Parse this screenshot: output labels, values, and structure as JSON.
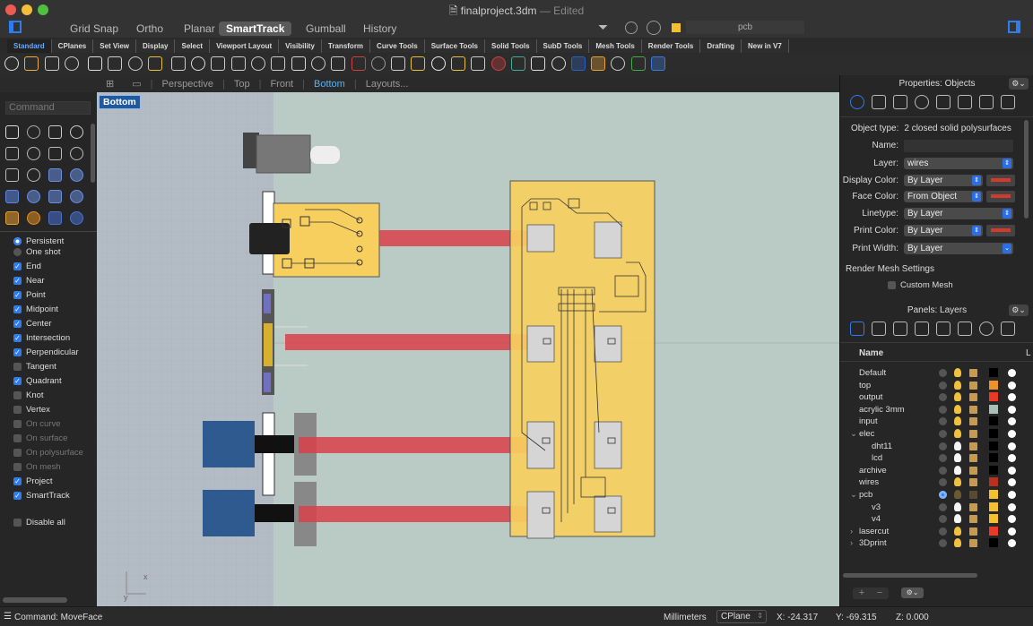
{
  "window": {
    "title": "finalproject.3dm",
    "edited": "— Edited",
    "layer_field": "pcb"
  },
  "modes": [
    "Grid Snap",
    "Ortho",
    "Planar",
    "SmartTrack",
    "Gumball",
    "History"
  ],
  "active_mode": "SmartTrack",
  "tabs": [
    "Standard",
    "CPlanes",
    "Set View",
    "Display",
    "Select",
    "Viewport Layout",
    "Visibility",
    "Transform",
    "Curve Tools",
    "Surface Tools",
    "Solid Tools",
    "SubD Tools",
    "Mesh Tools",
    "Render Tools",
    "Drafting",
    "New in V7"
  ],
  "active_tab": "Standard",
  "viewport_tabs": [
    "Perspective",
    "Top",
    "Front",
    "Bottom",
    "Layouts..."
  ],
  "active_viewport": "Bottom",
  "viewport_label": "Bottom",
  "axis": {
    "x": "x",
    "y": "y"
  },
  "command": {
    "placeholder": "Command"
  },
  "osnap": {
    "mode": [
      {
        "label": "Persistent",
        "on": true
      },
      {
        "label": "One shot",
        "on": false
      }
    ],
    "items": [
      {
        "label": "End",
        "on": true
      },
      {
        "label": "Near",
        "on": true
      },
      {
        "label": "Point",
        "on": true
      },
      {
        "label": "Midpoint",
        "on": true
      },
      {
        "label": "Center",
        "on": true
      },
      {
        "label": "Intersection",
        "on": true
      },
      {
        "label": "Perpendicular",
        "on": true
      },
      {
        "label": "Tangent",
        "on": false
      },
      {
        "label": "Quadrant",
        "on": true
      },
      {
        "label": "Knot",
        "on": false
      },
      {
        "label": "Vertex",
        "on": false
      },
      {
        "label": "On curve",
        "on": false,
        "disabled": true
      },
      {
        "label": "On surface",
        "on": false,
        "disabled": true
      },
      {
        "label": "On polysurface",
        "on": false,
        "disabled": true
      },
      {
        "label": "On mesh",
        "on": false,
        "disabled": true
      },
      {
        "label": "Project",
        "on": true
      },
      {
        "label": "SmartTrack",
        "on": true
      }
    ],
    "disable_all": "Disable all"
  },
  "properties": {
    "title": "Properties: Objects",
    "object_type_label": "Object type:",
    "object_type": "2 closed solid polysurfaces",
    "name_label": "Name:",
    "name_value": "",
    "layer_label": "Layer:",
    "layer": "wires",
    "display_color_label": "Display Color:",
    "display_color": "By Layer",
    "face_color_label": "Face Color:",
    "face_color": "From Object",
    "linetype_label": "Linetype:",
    "linetype": "By Layer",
    "print_color_label": "Print Color:",
    "print_color": "By Layer",
    "print_width_label": "Print Width:",
    "print_width": "By Layer",
    "render_mesh": "Render Mesh Settings",
    "custom_mesh": "Custom Mesh",
    "swatch_color": "#d03b2b"
  },
  "layers": {
    "title": "Panels: Layers",
    "name_header": "Name",
    "col_l": "L",
    "rows": [
      {
        "name": "Default",
        "indent": 0,
        "color": "#000000",
        "light": "on"
      },
      {
        "name": "top",
        "indent": 0,
        "color": "#f0902a",
        "light": "on"
      },
      {
        "name": "output",
        "indent": 0,
        "color": "#e83a25",
        "light": "on"
      },
      {
        "name": "acrylic 3mm",
        "indent": 0,
        "color": "#a8c0b8",
        "light": "on"
      },
      {
        "name": "input",
        "indent": 0,
        "color": "#000000",
        "light": "on"
      },
      {
        "name": "elec",
        "indent": 0,
        "color": "#000000",
        "light": "on",
        "expander": "v"
      },
      {
        "name": "dht11",
        "indent": 1,
        "color": "#000000",
        "light": "off"
      },
      {
        "name": "lcd",
        "indent": 1,
        "color": "#000000",
        "light": "off"
      },
      {
        "name": "archive",
        "indent": 0,
        "color": "#000000",
        "light": "off"
      },
      {
        "name": "wires",
        "indent": 0,
        "color": "#b83020",
        "light": "on"
      },
      {
        "name": "pcb",
        "indent": 0,
        "color": "#f5c030",
        "light": "dim",
        "expander": "v",
        "current": true
      },
      {
        "name": "v3",
        "indent": 1,
        "color": "#f5c030",
        "light": "off"
      },
      {
        "name": "v4",
        "indent": 1,
        "color": "#f5c030",
        "light": "off"
      },
      {
        "name": "lasercut",
        "indent": 0,
        "color": "#e83a25",
        "light": "on",
        "expander": ">"
      },
      {
        "name": "3Dprint",
        "indent": 0,
        "color": "#000000",
        "light": "on",
        "expander": ">"
      }
    ],
    "add": "+",
    "remove": "−"
  },
  "status": {
    "command": "Command: MoveFace",
    "units": "Millimeters",
    "cplane": "CPlane",
    "x": "X: -24.317",
    "y": "Y: -69.315",
    "z": "Z: 0.000"
  },
  "colors": {
    "accent": "#2d7cf0",
    "pcb": "#f7cf5f",
    "wire": "#d9414a",
    "viewport_bg": "#b9cbc4"
  }
}
